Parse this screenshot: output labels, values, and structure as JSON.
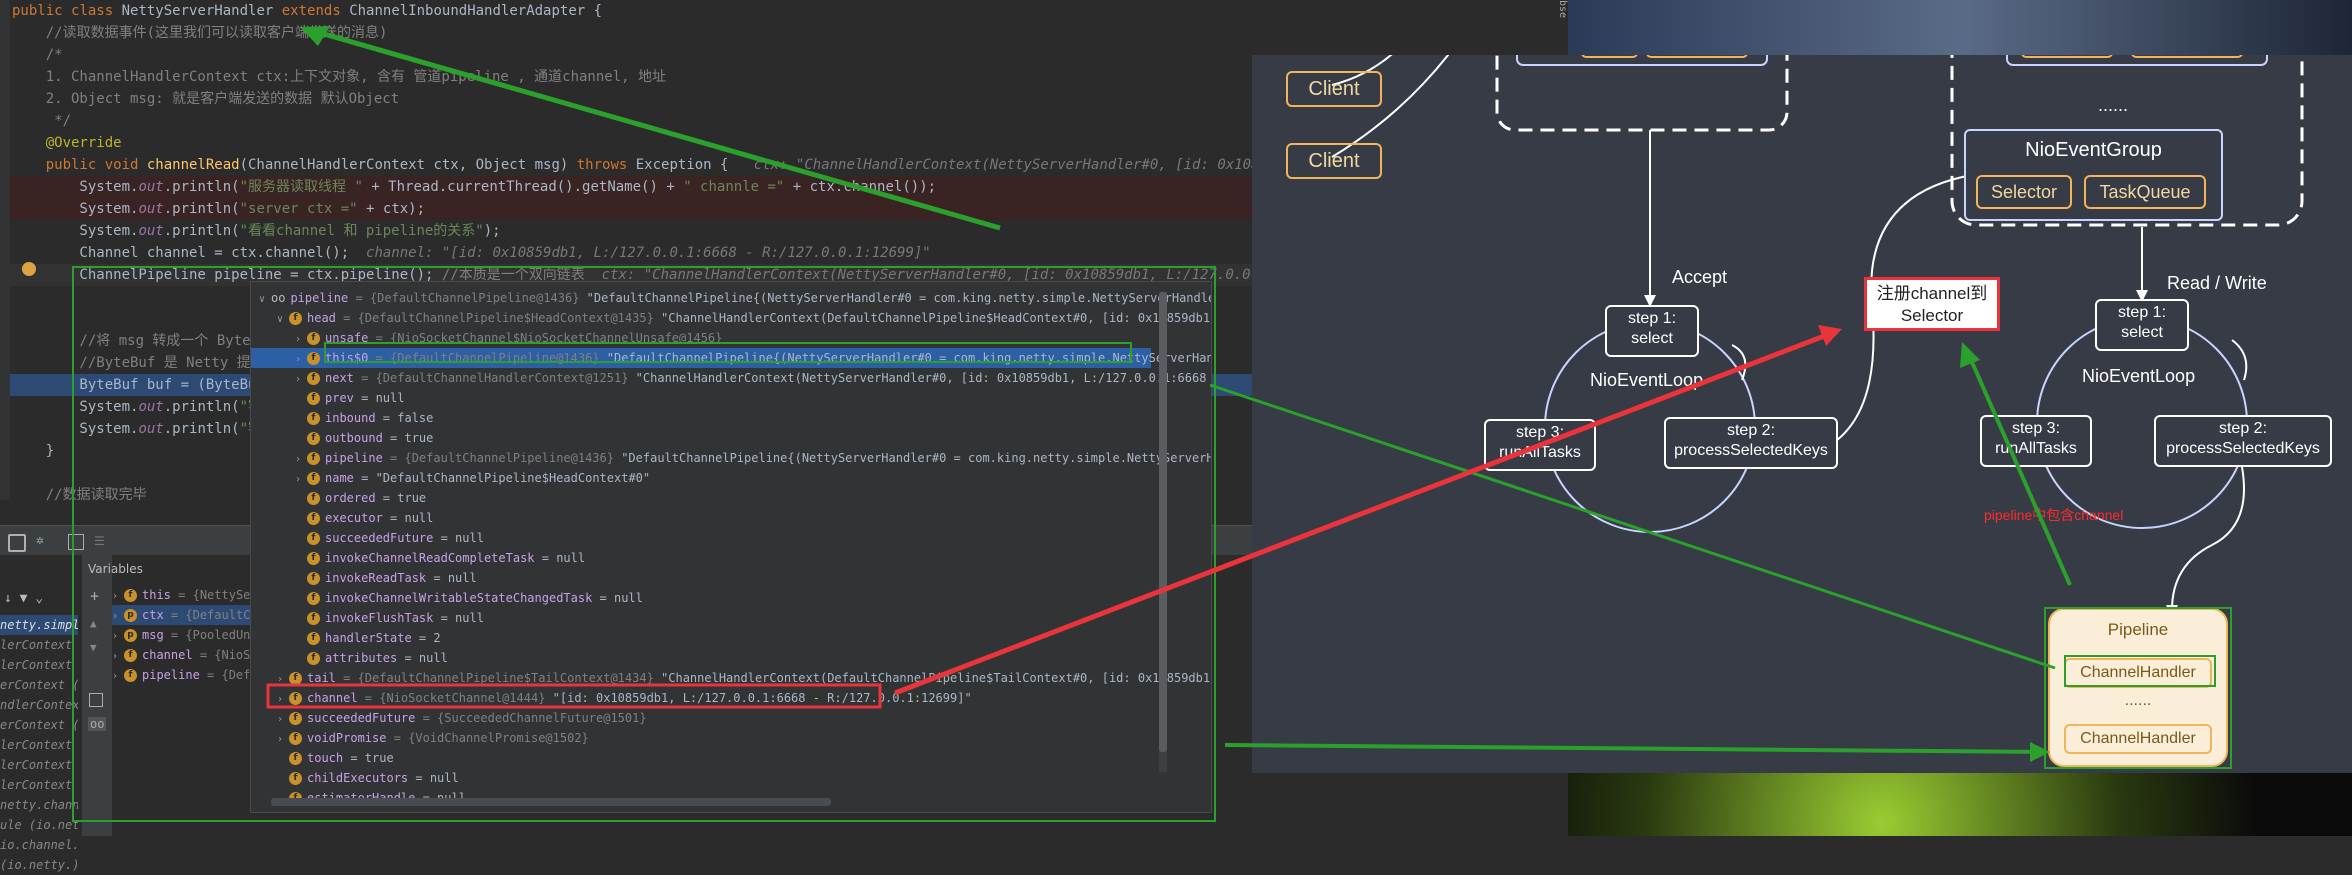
{
  "editor": {
    "lines": [
      {
        "segments": [
          {
            "t": "public ",
            "c": "kw"
          },
          {
            "t": "class ",
            "c": "kw"
          },
          {
            "t": "NettyServerHandler ",
            "c": ""
          },
          {
            "t": "extends ",
            "c": "kw"
          },
          {
            "t": "ChannelInboundHandlerAdapter {",
            "c": ""
          }
        ]
      },
      {
        "segments": [
          {
            "t": "    //读取数据事件(这里我们可以读取客户端发送的消息)",
            "c": "cm"
          }
        ]
      },
      {
        "segments": [
          {
            "t": "    /*",
            "c": "cm"
          }
        ]
      },
      {
        "segments": [
          {
            "t": "    1. ChannelHandlerContext ctx:上下文对象, 含有 管道pipeline , 通道channel, 地址",
            "c": "cm"
          }
        ]
      },
      {
        "segments": [
          {
            "t": "    2. Object msg: 就是客户端发送的数据 默认Object",
            "c": "cm"
          }
        ]
      },
      {
        "segments": [
          {
            "t": "     */",
            "c": "cm"
          }
        ]
      },
      {
        "segments": [
          {
            "t": "    @Override",
            "c": "an"
          }
        ]
      },
      {
        "segments": [
          {
            "t": "    public void ",
            "c": "kw"
          },
          {
            "t": "channelRead",
            "c": "fn"
          },
          {
            "t": "(ChannelHandlerContext ctx, Object msg) ",
            "c": ""
          },
          {
            "t": "throws ",
            "c": "kw"
          },
          {
            "t": "Exception {   ",
            "c": ""
          },
          {
            "t": "ctx: \"ChannelHandlerContext(NettyServerHandler#0, [id: 0x10859db1, L",
            "c": "hint"
          }
        ]
      },
      {
        "segments": [
          {
            "t": "        System.",
            "c": ""
          },
          {
            "t": "out",
            "c": "it"
          },
          {
            "t": ".println(",
            "c": ""
          },
          {
            "t": "\"服务器读取线程 \"",
            "c": "st"
          },
          {
            "t": " + Thread.currentThread().getName() + ",
            "c": ""
          },
          {
            "t": "\" channle =\"",
            "c": "st"
          },
          {
            "t": " + ctx.channel());",
            "c": ""
          }
        ]
      },
      {
        "segments": [
          {
            "t": "        System.",
            "c": ""
          },
          {
            "t": "out",
            "c": "it"
          },
          {
            "t": ".println(",
            "c": ""
          },
          {
            "t": "\"server ctx =\"",
            "c": "st"
          },
          {
            "t": " + ctx);",
            "c": ""
          }
        ]
      },
      {
        "segments": [
          {
            "t": "        System.",
            "c": ""
          },
          {
            "t": "out",
            "c": "it"
          },
          {
            "t": ".println(",
            "c": ""
          },
          {
            "t": "\"看看channel 和 pipeline的关系\"",
            "c": "st"
          },
          {
            "t": ");",
            "c": ""
          }
        ]
      },
      {
        "segments": [
          {
            "t": "        Channel channel = ctx.channel();  ",
            "c": ""
          },
          {
            "t": "channel: \"[id: 0x10859db1, L:/127.0.0.1:6668 - R:/127.0.0.1:12699]\"",
            "c": "hint"
          }
        ]
      },
      {
        "segments": [
          {
            "t": "        ChannelPipeline pipeline = ctx.pipeline(); ",
            "c": ""
          },
          {
            "t": "//本质是一个双向链表  ",
            "c": "cm"
          },
          {
            "t": "ctx: \"ChannelHandlerContext(NettyServerHandler#0, [id: 0x10859db1, L:/127.0.0.1:6668",
            "c": "hint"
          }
        ]
      },
      {
        "segments": [
          {
            "t": "",
            "c": ""
          }
        ]
      },
      {
        "segments": [
          {
            "t": "",
            "c": ""
          }
        ]
      },
      {
        "segments": [
          {
            "t": "        //将 msg 转成一个 ByteBu",
            "c": "cm"
          }
        ]
      },
      {
        "segments": [
          {
            "t": "        //ByteBuf 是 Netty 提供",
            "c": "cm"
          }
        ]
      },
      {
        "segments": [
          {
            "t": "        ByteBuf buf = (ByteBuf",
            "c": ""
          }
        ]
      },
      {
        "segments": [
          {
            "t": "        System.",
            "c": ""
          },
          {
            "t": "out",
            "c": "it"
          },
          {
            "t": ".println(",
            "c": ""
          },
          {
            "t": "\"客",
            "c": "st"
          }
        ]
      },
      {
        "segments": [
          {
            "t": "        System.",
            "c": ""
          },
          {
            "t": "out",
            "c": "it"
          },
          {
            "t": ".println(",
            "c": ""
          },
          {
            "t": "\"客",
            "c": "st"
          }
        ]
      },
      {
        "segments": [
          {
            "t": "    }",
            "c": ""
          }
        ]
      },
      {
        "segments": [
          {
            "t": "",
            "c": ""
          }
        ]
      },
      {
        "segments": [
          {
            "t": "    //数据读取完毕",
            "c": "cm"
          }
        ]
      }
    ]
  },
  "debug": {
    "variables_label": "Variables",
    "frames": [
      "netty.simple)",
      "lerContext (io.",
      "lerContext (io.",
      "erContext (io.n",
      "ndlerContext (io.",
      "erContext (io.n",
      "lerContext (io.",
      "lerContext (io.",
      "lerContext (io.",
      "netty.channel",
      "ule (io.netty.c",
      "io.channel.nio",
      "(io.netty.)"
    ],
    "vars": [
      {
        "name": "this",
        "val": "= {NettyServer",
        "icon": "f"
      },
      {
        "name": "ctx",
        "val": "= {DefaultChannel",
        "icon": "p"
      },
      {
        "name": "msg",
        "val": "= {PooledUns",
        "icon": "p"
      },
      {
        "name": "channel",
        "val": "= {NioSoc",
        "icon": "f"
      },
      {
        "name": "pipeline",
        "val": "= {Default",
        "icon": "f"
      }
    ]
  },
  "popup": {
    "rows": [
      {
        "ind": 0,
        "arrow": "∨",
        "icon": "oo",
        "name": "pipeline",
        "gray": " = {DefaultChannelPipeline@1436}",
        "str": " \"DefaultChannelPipeline{(NettyServerHandler#0 = com.king.netty.simple.NettyServerHandler)}\""
      },
      {
        "ind": 1,
        "arrow": "∨",
        "icon": "f",
        "name": "head",
        "gray": " = {DefaultChannelPipeline$HeadContext@1435}",
        "str": " \"ChannelHandlerContext(DefaultChannelPipeline$HeadContext#0, [id: 0x10859db1, L:/127.0.0.1:6668 -"
      },
      {
        "ind": 2,
        "arrow": "›",
        "icon": "f",
        "name": "unsafe",
        "gray": " = {NioSocketChannel$NioSocketChannelUnsafe@1456}",
        "str": ""
      },
      {
        "ind": 2,
        "arrow": "›",
        "icon": "f",
        "name": "this$0",
        "gray": " = {DefaultChannelPipeline@1436}",
        "str": " \"DefaultChannelPipeline{(NettyServerHandler#0 = com.king.netty.simple.NettyServerHandler)}\"",
        "sel": true
      },
      {
        "ind": 2,
        "arrow": "›",
        "icon": "f",
        "name": "next",
        "gray": " = {DefaultChannelHandlerContext@1251}",
        "str": " \"ChannelHandlerContext(NettyServerHandler#0, [id: 0x10859db1, L:/127.0.0.1:6668 - R:/127.0.0.1:12699])\""
      },
      {
        "ind": 2,
        "arrow": "",
        "icon": "f",
        "name": "prev",
        "gray": "",
        "str": " = null"
      },
      {
        "ind": 2,
        "arrow": "",
        "icon": "f",
        "name": "inbound",
        "gray": "",
        "str": " = false"
      },
      {
        "ind": 2,
        "arrow": "",
        "icon": "f",
        "name": "outbound",
        "gray": "",
        "str": " = true"
      },
      {
        "ind": 2,
        "arrow": "›",
        "icon": "f",
        "name": "pipeline",
        "gray": " = {DefaultChannelPipeline@1436}",
        "str": " \"DefaultChannelPipeline{(NettyServerHandler#0 = com.king.netty.simple.NettyServerHandler)}\""
      },
      {
        "ind": 2,
        "arrow": "›",
        "icon": "f",
        "name": "name",
        "gray": "",
        "str": " = \"DefaultChannelPipeline$HeadContext#0\""
      },
      {
        "ind": 2,
        "arrow": "",
        "icon": "f",
        "name": "ordered",
        "gray": "",
        "str": " = true"
      },
      {
        "ind": 2,
        "arrow": "",
        "icon": "f",
        "name": "executor",
        "gray": "",
        "str": " = null"
      },
      {
        "ind": 2,
        "arrow": "",
        "icon": "f",
        "name": "succeededFuture",
        "gray": "",
        "str": " = null"
      },
      {
        "ind": 2,
        "arrow": "",
        "icon": "f",
        "name": "invokeChannelReadCompleteTask",
        "gray": "",
        "str": " = null"
      },
      {
        "ind": 2,
        "arrow": "",
        "icon": "f",
        "name": "invokeReadTask",
        "gray": "",
        "str": " = null"
      },
      {
        "ind": 2,
        "arrow": "",
        "icon": "f",
        "name": "invokeChannelWritableStateChangedTask",
        "gray": "",
        "str": " = null"
      },
      {
        "ind": 2,
        "arrow": "",
        "icon": "f",
        "name": "invokeFlushTask",
        "gray": "",
        "str": " = null"
      },
      {
        "ind": 2,
        "arrow": "",
        "icon": "f",
        "name": "handlerState",
        "gray": "",
        "str": " = 2"
      },
      {
        "ind": 2,
        "arrow": "",
        "icon": "f",
        "name": "attributes",
        "gray": "",
        "str": " = null"
      },
      {
        "ind": 1,
        "arrow": "›",
        "icon": "f",
        "name": "tail",
        "gray": " = {DefaultChannelPipeline$TailContext@1434}",
        "str": " \"ChannelHandlerContext(DefaultChannelPipeline$TailContext#0, [id: 0x10859db1, L:/127.0.0.1:6668 - R:/12"
      },
      {
        "ind": 1,
        "arrow": "›",
        "icon": "f",
        "name": "channel",
        "gray": " = {NioSocketChannel@1444}",
        "str": " \"[id: 0x10859db1, L:/127.0.0.1:6668 - R:/127.0.0.1:12699]\"",
        "boxed": true
      },
      {
        "ind": 1,
        "arrow": "›",
        "icon": "f",
        "name": "succeededFuture",
        "gray": " = {SucceededChannelFuture@1501}",
        "str": ""
      },
      {
        "ind": 1,
        "arrow": "›",
        "icon": "f",
        "name": "voidPromise",
        "gray": " = {VoidChannelPromise@1502}",
        "str": ""
      },
      {
        "ind": 1,
        "arrow": "",
        "icon": "f",
        "name": "touch",
        "gray": "",
        "str": " = true"
      },
      {
        "ind": 1,
        "arrow": "",
        "icon": "f",
        "name": "childExecutors",
        "gray": "",
        "str": " = null"
      },
      {
        "ind": 1,
        "arrow": "",
        "icon": "f",
        "name": "estimatorHandle",
        "gray": "",
        "str": " = null"
      }
    ]
  },
  "diagram": {
    "client1": "Client",
    "client2": "Client",
    "accept": "Accept",
    "read_write": "Read / Write",
    "dots_top": "......",
    "nio_group": "NioEventGroup",
    "selector": "Selector",
    "taskqueue": "TaskQueue",
    "loop1": {
      "title": "NioEventLoop",
      "s1a": "step 1:",
      "s1b": "select",
      "s2a": "step 2:",
      "s2b": "processSelectedKeys",
      "s3a": "step 3:",
      "s3b": "runAllTasks"
    },
    "loop2": {
      "title": "NioEventLoop",
      "s1a": "step 1:",
      "s1b": "select",
      "s2a": "step 2:",
      "s2b": "processSelectedKeys",
      "s3a": "step 3:",
      "s3b": "runAllTasks"
    },
    "register_note": "注册channel到Selector",
    "pipeline_note": "pipeline中包含channel",
    "pipeline_title": "Pipeline",
    "handler1": "ChannelHandler",
    "dots_mid": "......",
    "handler2": "ChannelHandler",
    "top_label": "Selector",
    "top_label2": "TaskQueue"
  },
  "colors": {
    "accent_red": "#e8343a",
    "accent_green": "#2ca02c",
    "orange": "#f0b45a",
    "diagram_bg": "#373b46"
  }
}
